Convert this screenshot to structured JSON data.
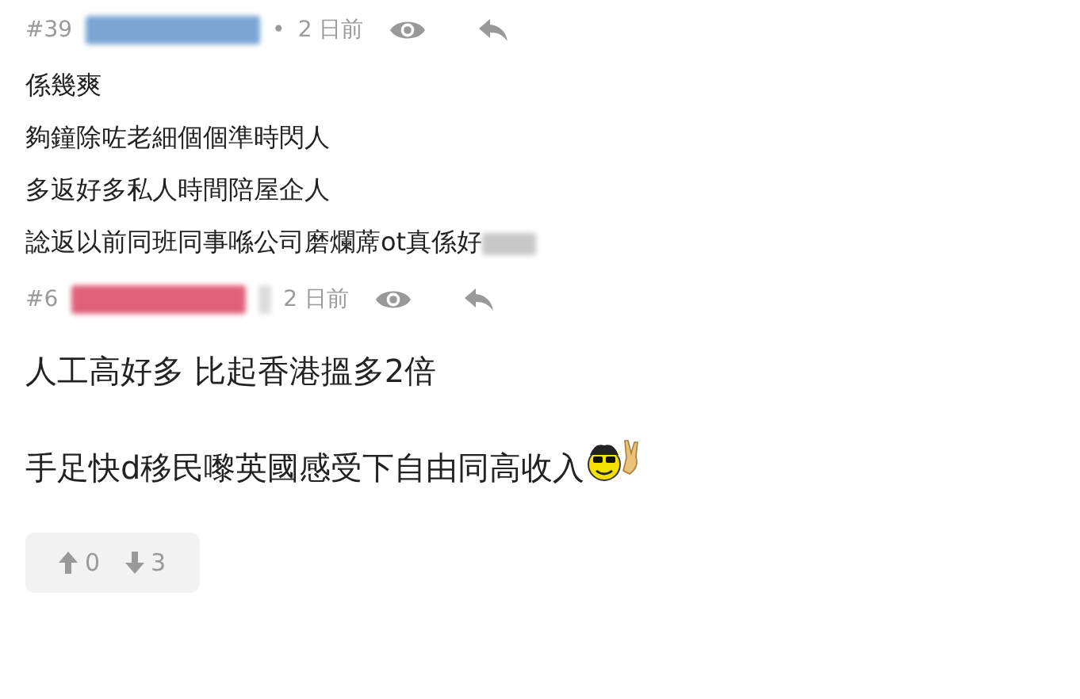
{
  "posts": [
    {
      "number": "#39",
      "color": "#7aa6d4",
      "separator": "•",
      "time": "2 日前",
      "kind": "normal",
      "lines": [
        {
          "text": "係幾爽",
          "kind": "plain"
        },
        {
          "text": "夠鐘除咗老細個個準時閃人",
          "kind": "plain"
        },
        {
          "text": "多返好多私人時間陪屋企人",
          "kind": "plain"
        },
        {
          "text": "諗返以前同班同事喺公司磨爛蓆ot真係好",
          "kind": "blurred-end"
        }
      ]
    },
    {
      "number": "#6",
      "color": "#e0607a",
      "time": "2 日前",
      "kind": "large",
      "lines": [
        {
          "text": "人工高好多 比起香港搵多2倍",
          "kind": "plain"
        },
        {
          "text": "手足快d移民嚟英國感受下自由同高收入",
          "kind": "emoji-end"
        }
      ]
    }
  ],
  "votes": {
    "up": "0",
    "down": "3"
  }
}
